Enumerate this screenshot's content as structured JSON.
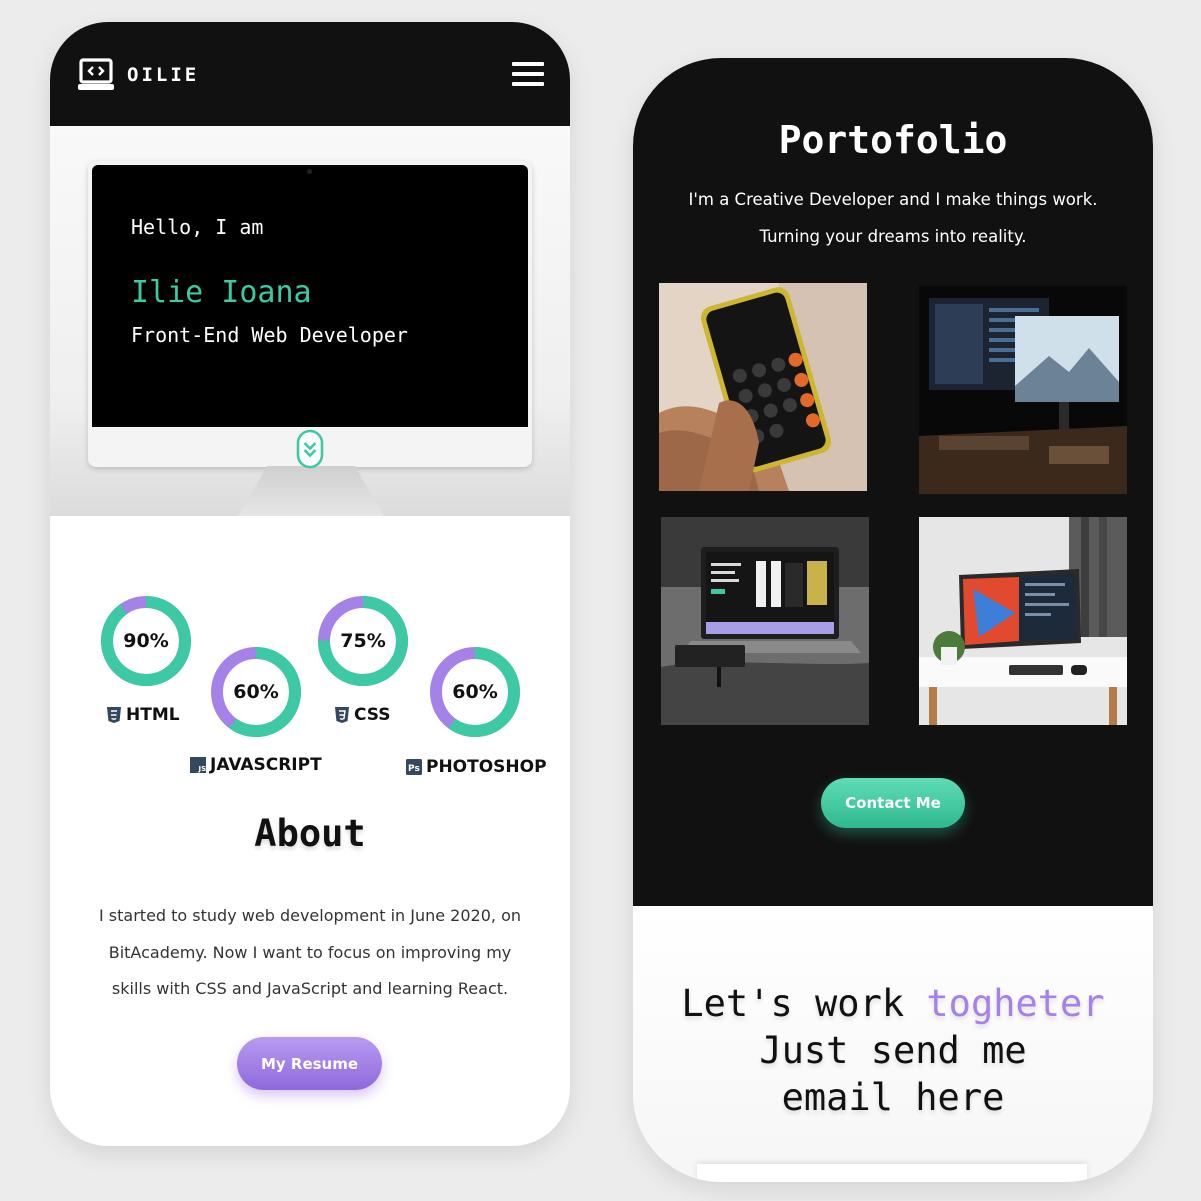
{
  "colors": {
    "accent_green": "#3dc9a4",
    "accent_purple": "#a582e8",
    "dark_bg": "#111111"
  },
  "left_phone": {
    "navbar": {
      "logo_icon": "laptop-code-icon",
      "brand": "OILIE",
      "menu_icon": "hamburger-menu-icon"
    },
    "hero": {
      "greeting": "Hello, I am",
      "name": "Ilie Ioana",
      "role": "Front-End Web Developer",
      "scroll_icon": "double-chevron-down-icon"
    },
    "skills": [
      {
        "name": "HTML",
        "percent_label": "90%",
        "percent": 90,
        "icon": "html5-icon"
      },
      {
        "name": "JAVASCRIPT",
        "percent_label": "60%",
        "percent": 60,
        "icon": "javascript-icon"
      },
      {
        "name": "CSS",
        "percent_label": "75%",
        "percent": 75,
        "icon": "css3-icon"
      },
      {
        "name": "PHOTOSHOP",
        "percent_label": "60%",
        "percent": 60,
        "icon": "photoshop-icon"
      }
    ],
    "about": {
      "title": "About",
      "text_lines": [
        "I started to study web development in June 2020, on",
        "BitAcademy. Now I want to focus on improving my",
        "skills with CSS and JavaScript and learning React."
      ],
      "resume_button": "My Resume"
    }
  },
  "right_phone": {
    "portfolio": {
      "title": "Portofolio",
      "subtitle_lines": [
        "I'm a Creative Developer and I make things work.",
        "Turning your dreams into reality."
      ],
      "projects": [
        {
          "image": "calculator-phone-photo"
        },
        {
          "image": "dark-desk-monitor-photo"
        },
        {
          "image": "laptop-website-photo"
        },
        {
          "image": "white-desk-monitors-photo"
        }
      ],
      "contact_button": "Contact Me"
    },
    "cta": {
      "line1_start": "Let's work ",
      "line1_accent": "togheter",
      "line2": "Just send me",
      "line3": "email here"
    }
  }
}
